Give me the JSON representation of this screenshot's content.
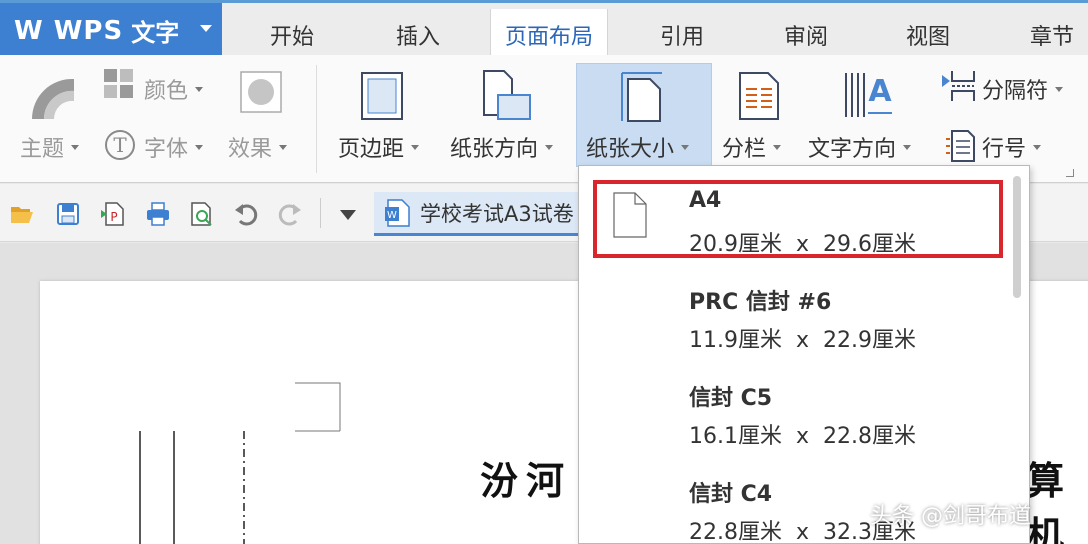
{
  "app": {
    "logo": "W WPS",
    "title": "文字"
  },
  "tabs": [
    "开始",
    "插入",
    "页面布局",
    "引用",
    "审阅",
    "视图",
    "章节"
  ],
  "ribbon": {
    "theme": "主题",
    "color": "颜色",
    "font": "字体",
    "effect": "效果",
    "margins": "页边距",
    "orientation": "纸张方向",
    "paper_size": "纸张大小",
    "columns": "分栏",
    "text_direction": "文字方向",
    "separator": "分隔符",
    "line_numbers": "行号"
  },
  "doc_tab": {
    "title": "学校考试A3试卷"
  },
  "document": {
    "heading_left": "汾河",
    "heading_right": "算机"
  },
  "paper_sizes": [
    {
      "name": "A4",
      "width": "20.9厘米",
      "x": "x",
      "height": "29.6厘米",
      "selected": true
    },
    {
      "name": "PRC 信封 #6",
      "width": "11.9厘米",
      "x": "x",
      "height": "22.9厘米",
      "selected": false
    },
    {
      "name": "信封 C5",
      "width": "16.1厘米",
      "x": "x",
      "height": "22.8厘米",
      "selected": false
    },
    {
      "name": "信封 C4",
      "width": "22.8厘米",
      "x": "x",
      "height": "32.3厘米",
      "selected": false
    }
  ],
  "watermark": "头条 @剑哥布道",
  "colors": {
    "accent": "#3d7fd0",
    "highlight": "#d9262c",
    "active_tab_text": "#2b66b8"
  }
}
